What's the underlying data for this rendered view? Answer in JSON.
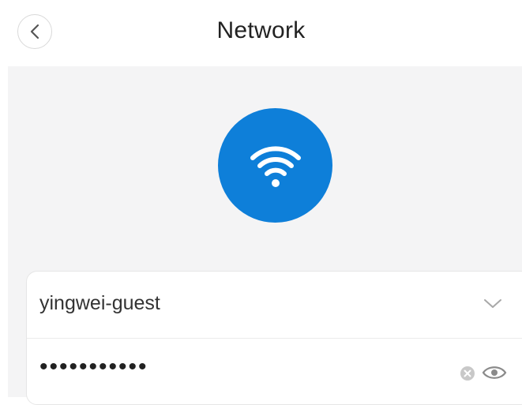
{
  "header": {
    "title": "Network",
    "back_icon": "chevron-left-icon"
  },
  "hero": {
    "icon": "wifi-icon",
    "color": "#0e7fd9"
  },
  "form": {
    "ssid": {
      "value": "yingwei-guest",
      "icon": "chevron-down-icon"
    },
    "password": {
      "value": "•••••••••••",
      "clear_icon": "clear-icon",
      "toggle_icon": "eye-icon"
    }
  },
  "colors": {
    "accent": "#0e7fd9",
    "background": "#f4f4f5"
  }
}
